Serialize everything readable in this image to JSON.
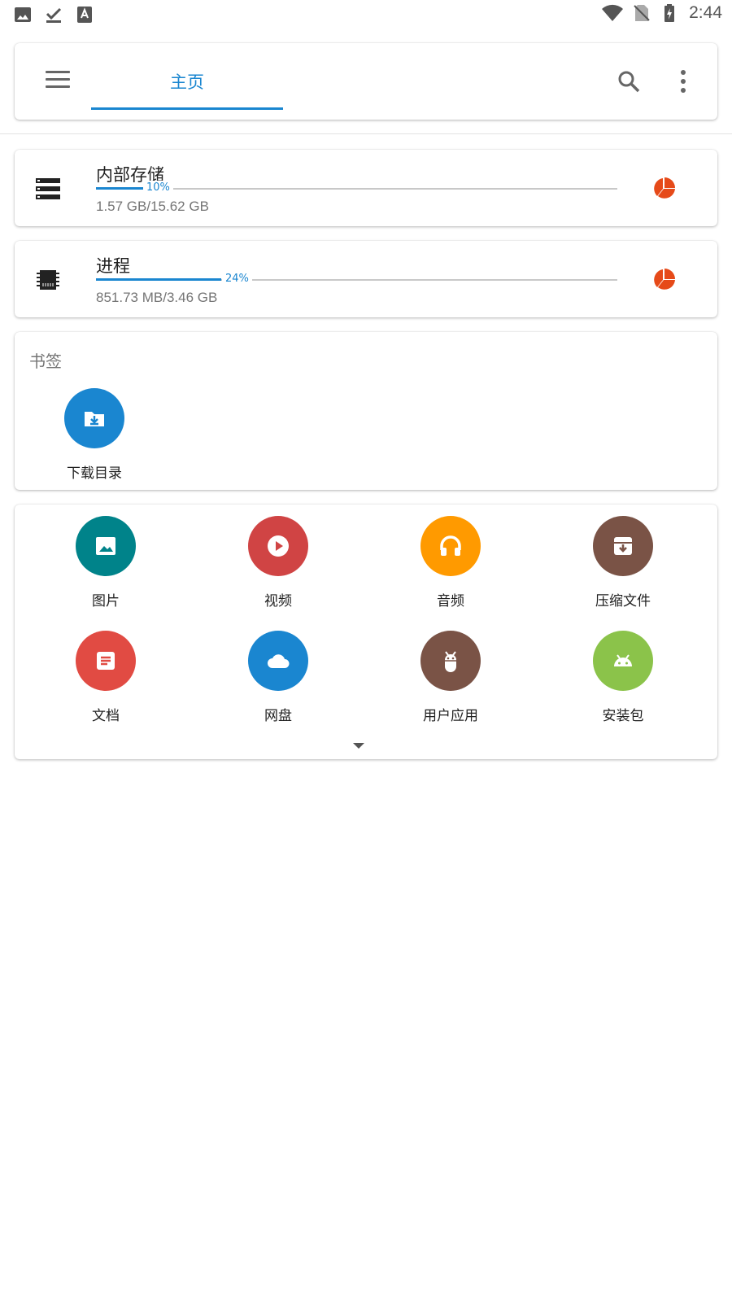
{
  "status_bar": {
    "time": "2:44",
    "left_icons": [
      "image-icon",
      "check-download-icon",
      "text-a-icon"
    ],
    "right_icons": [
      "wifi-icon",
      "no-sim-icon",
      "battery-charging-icon"
    ]
  },
  "toolbar": {
    "tab_home_label": "主页",
    "accent_color": "#1a86d0"
  },
  "storage": [
    {
      "title": "内部存储",
      "percent_label": "10%",
      "percent": 10,
      "detail": "1.57 GB/15.62 GB",
      "icon": "storage-icon"
    },
    {
      "title": "进程",
      "percent_label": "24%",
      "percent": 24,
      "detail": "851.73 MB/3.46 GB",
      "icon": "chip-icon"
    }
  ],
  "bookmarks": {
    "title": "书签",
    "items": [
      {
        "label": "下载目录",
        "color": "#1a86d0",
        "icon": "download-folder-icon"
      }
    ]
  },
  "categories": [
    {
      "label": "图片",
      "color": "#00838a",
      "icon": "image-icon"
    },
    {
      "label": "视频",
      "color": "#d04444",
      "icon": "play-icon"
    },
    {
      "label": "音频",
      "color": "#ff9a00",
      "icon": "headphones-icon"
    },
    {
      "label": "压缩文件",
      "color": "#7a5346",
      "icon": "archive-icon"
    },
    {
      "label": "文档",
      "color": "#e14b43",
      "icon": "document-icon"
    },
    {
      "label": "网盘",
      "color": "#1a86d0",
      "icon": "cloud-icon"
    },
    {
      "label": "用户应用",
      "color": "#7a5346",
      "icon": "android-head-icon"
    },
    {
      "label": "安装包",
      "color": "#8bc34a",
      "icon": "android-icon"
    }
  ]
}
